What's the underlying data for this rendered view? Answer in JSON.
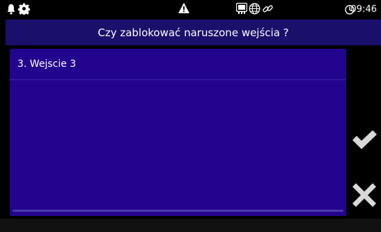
{
  "status_bar": {
    "time": "09:46",
    "icons": [
      "bell-icon",
      "gear-icon",
      "warning-icon",
      "network-icon",
      "globe-icon",
      "link-icon",
      "clock-icon"
    ]
  },
  "dialog": {
    "title": "Czy zablokować naruszone wejścia ?",
    "items": [
      {
        "label": "3. Wejscie 3"
      }
    ]
  },
  "actions": {
    "confirm_icon": "checkmark-icon",
    "cancel_icon": "x-icon"
  },
  "colors": {
    "header_bg": "#1a0f6b",
    "panel_bg": "#23048f",
    "icon_gray": "#d8d8d8"
  }
}
